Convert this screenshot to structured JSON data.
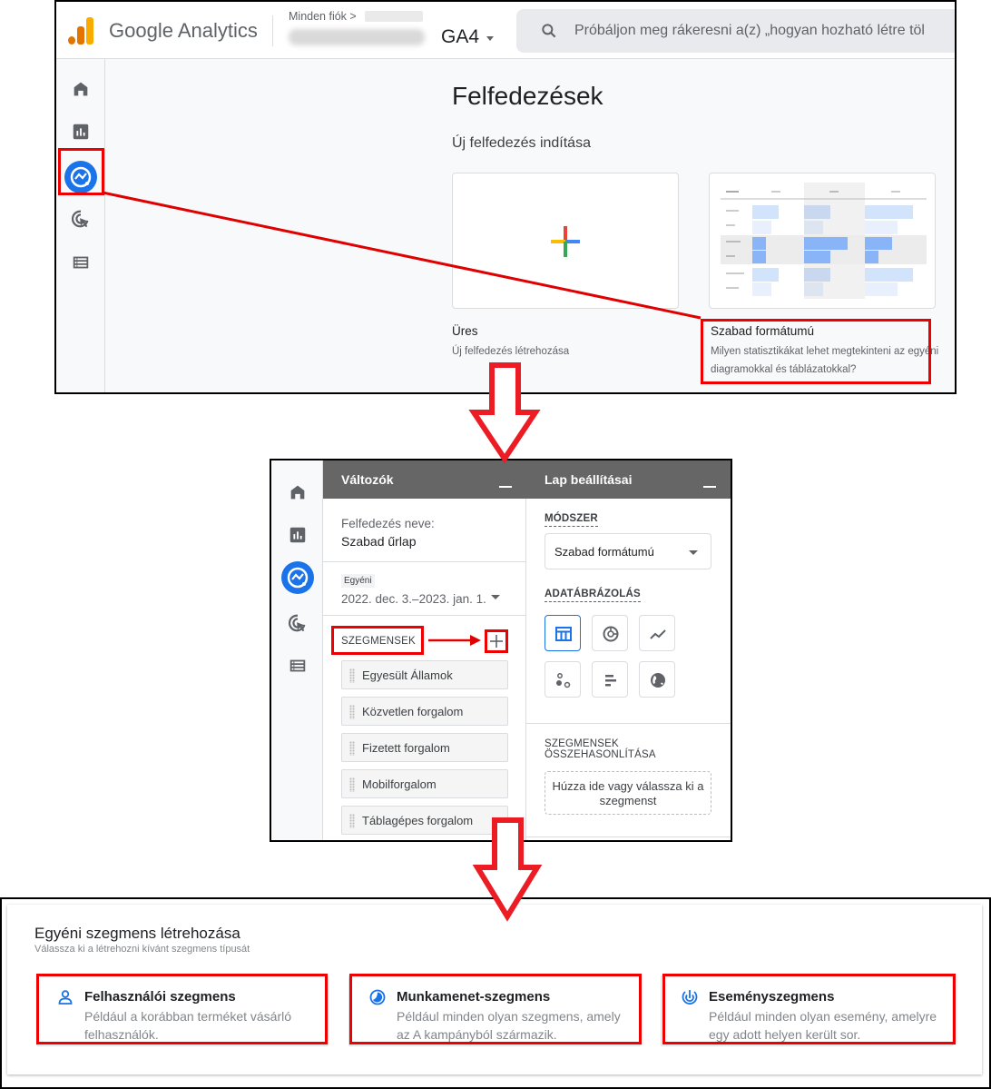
{
  "panel1": {
    "app_title": "Google Analytics",
    "breadcrumb": "Minden fiók >",
    "property": "GA4",
    "search_placeholder": "Próbáljon meg rákeresni a(z) „hogyan hozható létre töl",
    "nav": [
      "home-icon",
      "reports-icon",
      "explore-icon",
      "advertising-icon",
      "configure-icon"
    ],
    "page_title": "Felfedezések",
    "section_title": "Új felfedezés indítása",
    "tiles": [
      {
        "label": "Üres",
        "description": "Új felfedezés létrehozása"
      },
      {
        "label": "Szabad formátumú",
        "description": "Milyen statisztikákat lehet megtekinteni az egyéni diagramokkal és táblázatokkal?"
      }
    ]
  },
  "panel2": {
    "variables": {
      "header": "Változók",
      "name_label": "Felfedezés neve:",
      "name_value": "Szabad űrlap",
      "date_chip": "Egyéni",
      "date_range": "2022. dec. 3.–2023. jan. 1.",
      "segments_label": "SZEGMENSEK",
      "segments": [
        "Egyesült Államok",
        "Közvetlen forgalom",
        "Fizetett forgalom",
        "Mobilforgalom",
        "Táblagépes forgalom"
      ]
    },
    "settings": {
      "header": "Lap beállításai",
      "technique_label": "MÓDSZER",
      "technique_value": "Szabad formátumú",
      "visualization_label": "ADATÁBRÁZOLÁS",
      "visualizations": [
        "table",
        "donut",
        "line",
        "scatter",
        "bar",
        "geo"
      ],
      "selected_visualization": "table",
      "compare_label_1": "SZEGMENSEK",
      "compare_label_2": "ÖSSZEHASONLÍTÁSA",
      "dropzone_text": "Húzza ide vagy válassza ki a szegmenst"
    }
  },
  "panel3": {
    "title": "Egyéni szegmens létrehozása",
    "subtitle": "Válassza ki a létrehozni kívánt szegmens típusát",
    "cards": [
      {
        "icon": "user-icon",
        "name": "Felhasználói szegmens",
        "description": "Például a korábban terméket vásárló felhasználók."
      },
      {
        "icon": "session-icon",
        "name": "Munkamenet-szegmens",
        "description": "Például minden olyan szegmens, amely az A kampányból származik."
      },
      {
        "icon": "event-icon",
        "name": "Eseményszegmens",
        "description": "Például minden olyan esemény, amelyre egy adott helyen került sor."
      }
    ]
  },
  "colors": {
    "accent": "#1a73e8",
    "annotation_red": "#e00000",
    "header_gray": "#666666"
  }
}
